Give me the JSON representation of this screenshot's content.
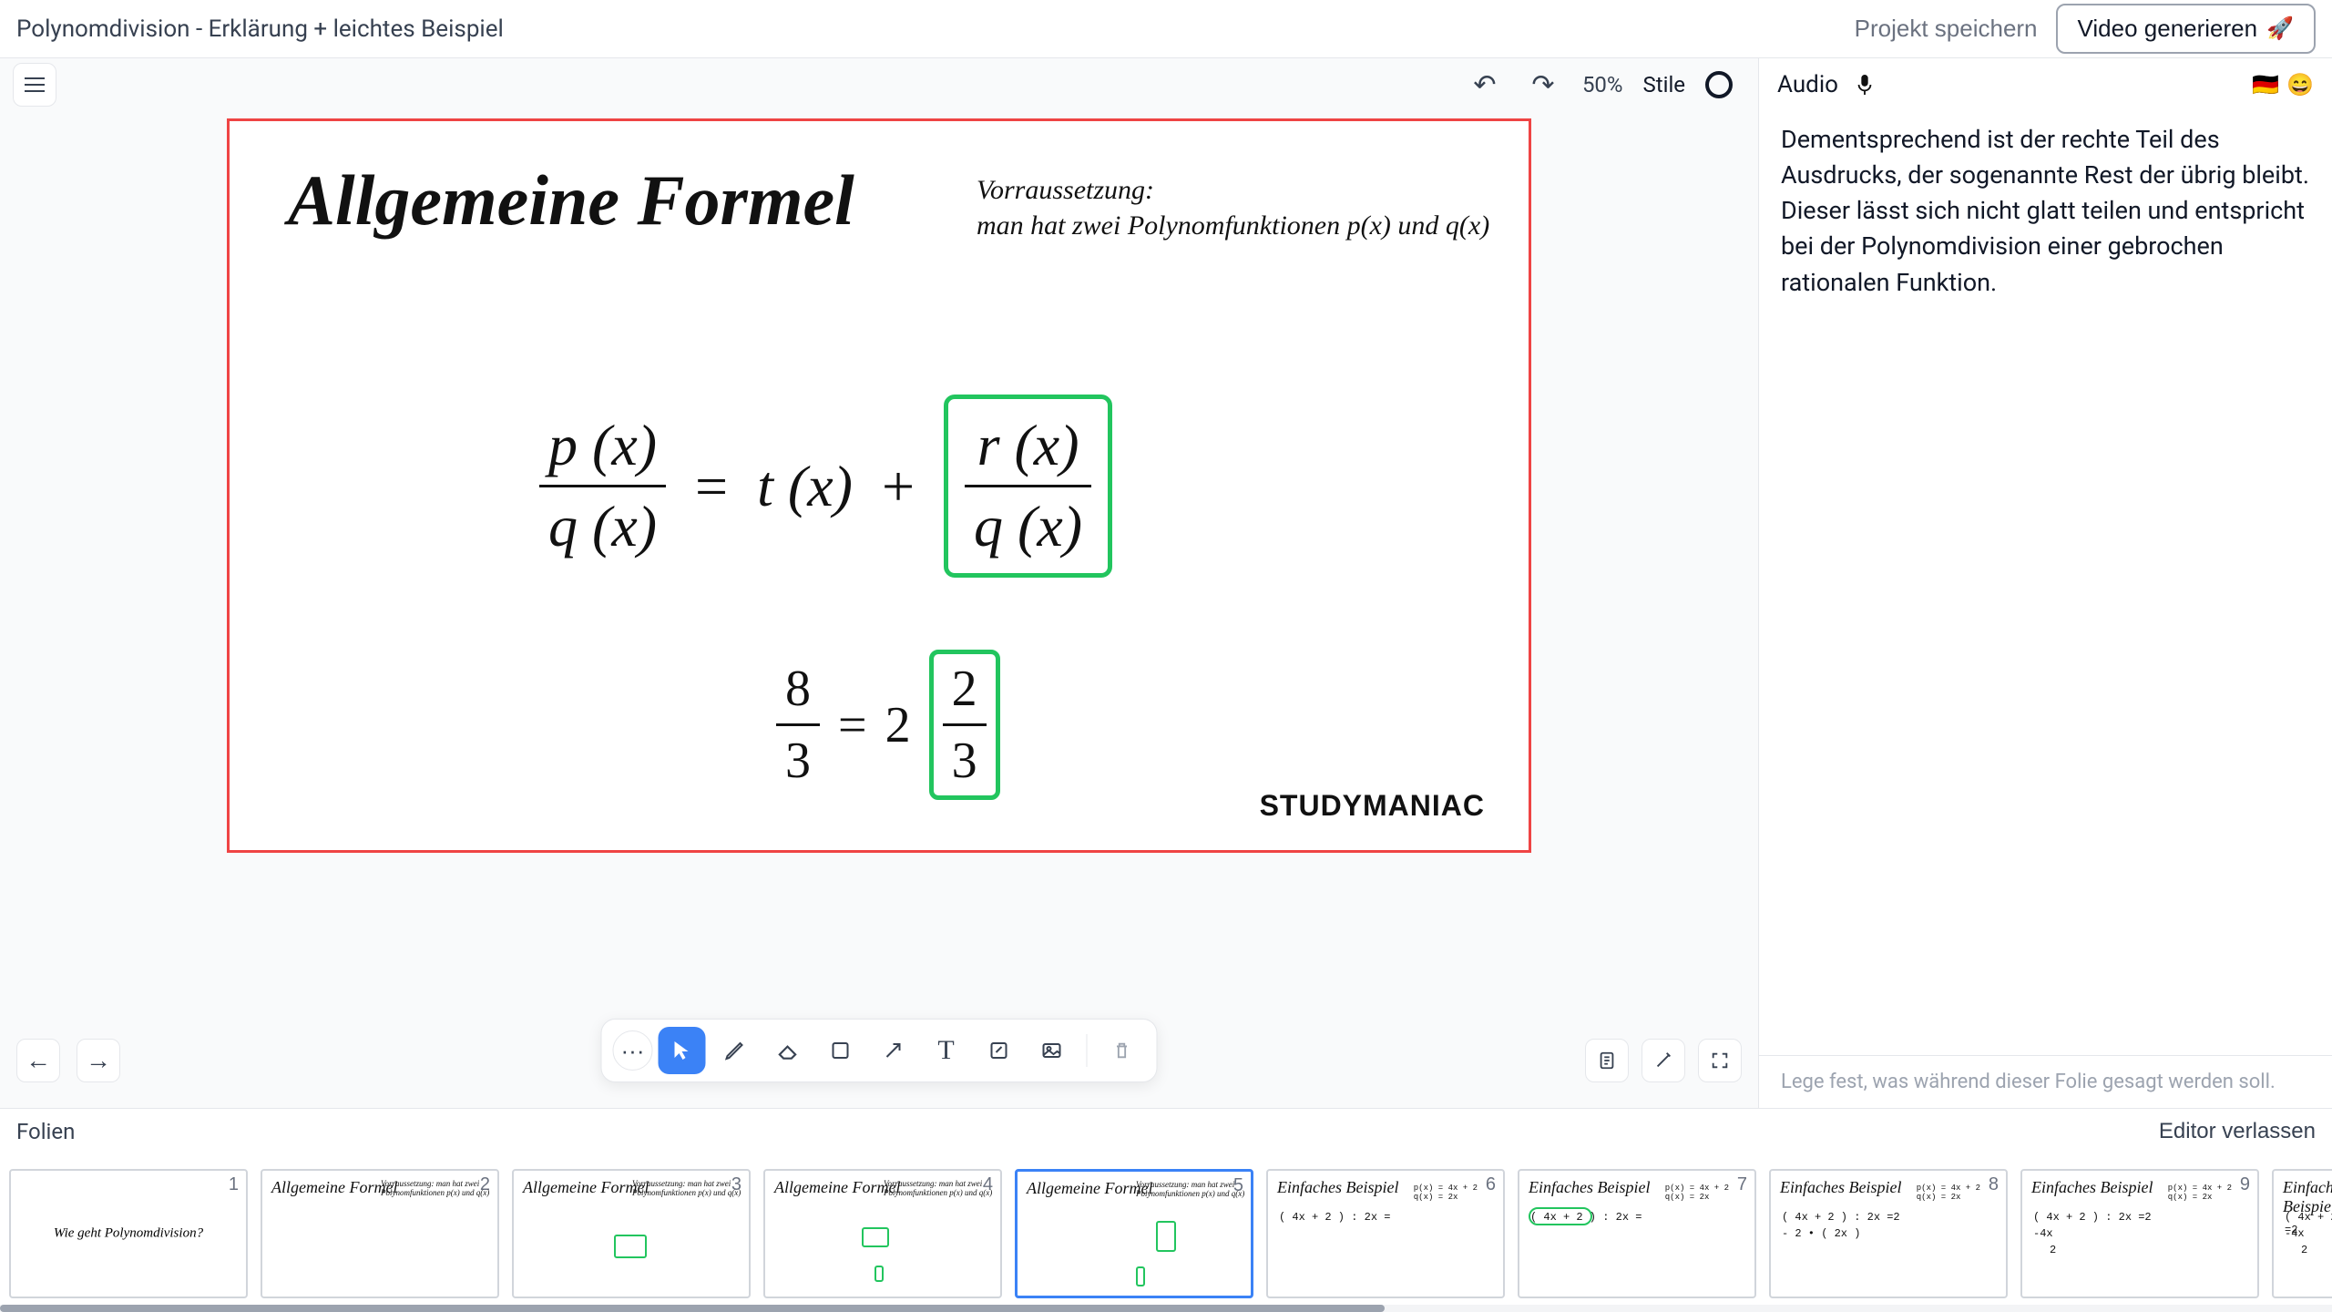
{
  "header": {
    "title": "Polynomdivision - Erklärung + leichtes Beispiel",
    "save_label": "Projekt speichern",
    "generate_label": "Video generieren"
  },
  "toolbar": {
    "zoom": "50%",
    "stile_label": "Stile"
  },
  "slide": {
    "title": "Allgemeine Formel",
    "prereq_label": "Vorraussetzung:",
    "prereq_text": "man hat zwei Polynomfunktionen p(x) und q(x)",
    "formula": {
      "p_over_q_num": "p (x)",
      "p_over_q_den": "q (x)",
      "eq": "=",
      "t_of_x": "t (x)",
      "plus": "+",
      "r_over_q_num": "r (x)",
      "r_over_q_den": "q (x)"
    },
    "example": {
      "lhs_num": "8",
      "lhs_den": "3",
      "eq": "=",
      "whole": "2",
      "frac_num": "2",
      "frac_den": "3"
    },
    "brand": "STUDYMANIAC"
  },
  "tools": {
    "select": "↖",
    "pencil": "✎",
    "eraser": "◇",
    "rect": "▭",
    "arrow": "↗",
    "text": "T",
    "note": "✎▢",
    "image": "⌬",
    "trash": "🗑",
    "dots": "···"
  },
  "audio": {
    "label": "Audio",
    "text": "Dementsprechend ist der rechte Teil des Ausdrucks, der sogenannte Rest der übrig bleibt. Dieser lässt sich nicht glatt teilen und entspricht bei der Polynomdivision einer gebrochen rationalen Funktion.",
    "hint": "Lege fest, was während dieser Folie gesagt werden soll."
  },
  "footer": {
    "folien_label": "Folien",
    "exit_label": "Editor verlassen"
  },
  "thumbs": [
    {
      "num": "1",
      "title": "",
      "center": "Wie geht Polynomdivision?"
    },
    {
      "num": "2",
      "title": "Allgemeine Formel"
    },
    {
      "num": "3",
      "title": "Allgemeine Formel"
    },
    {
      "num": "4",
      "title": "Allgemeine Formel"
    },
    {
      "num": "5",
      "title": "Allgemeine Formel"
    },
    {
      "num": "6",
      "title": "Einfaches Beispiel"
    },
    {
      "num": "7",
      "title": "Einfaches Beispiel"
    },
    {
      "num": "8",
      "title": "Einfaches Beispiel"
    },
    {
      "num": "9",
      "title": "Einfaches Beispiel"
    },
    {
      "num": "",
      "title": "Einfaches Beispiel"
    }
  ],
  "thumb_sub_lines": {
    "prereq_mini": "Vorraussetzung:\nman hat zwei Polynomfunktionen p(x) und q(x)",
    "eq_mini_6": "( 4x + 2 ) : 2x =",
    "eq_mini_7": "( 4x + 2 ) : 2x =",
    "eq_mini_8a": "( 4x + 2 ) : 2x =2",
    "eq_mini_8b": "- 2 • ( 2x )",
    "eq_mini_9a": "( 4x + 2 ) : 2x =2",
    "eq_mini_9b": "-4x",
    "eq_mini_9c": "2",
    "pqline": "p(x) = 4x + 2\nq(x) = 2x"
  }
}
